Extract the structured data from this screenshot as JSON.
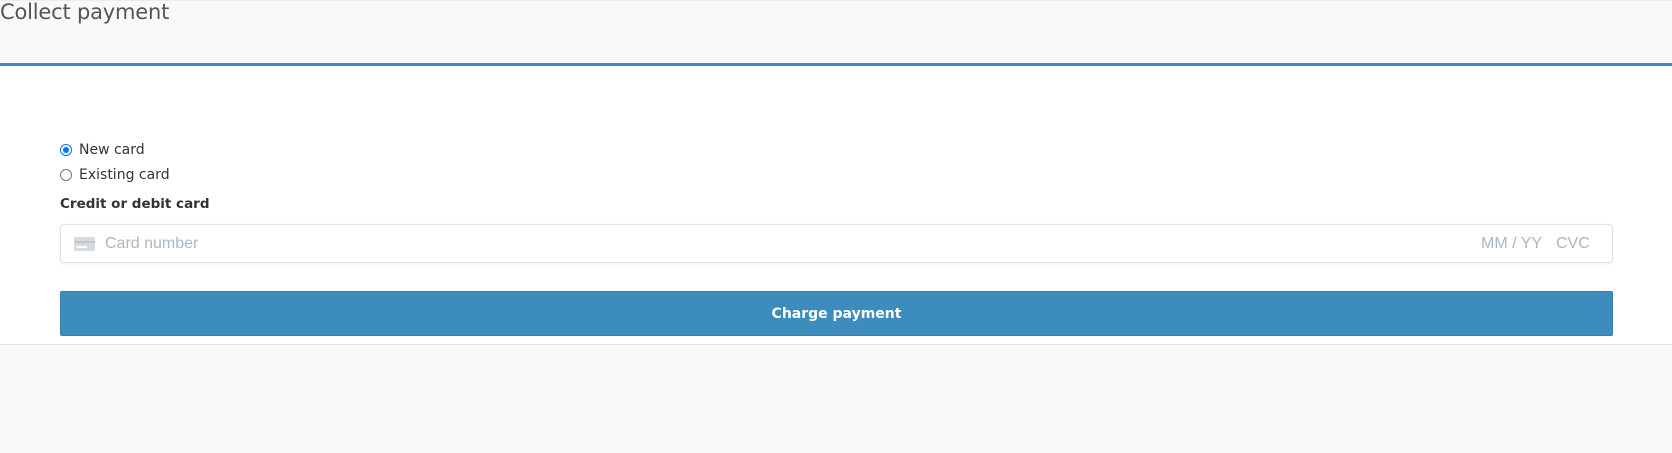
{
  "header": {
    "title": "Collect payment"
  },
  "payment": {
    "options": [
      {
        "label": "New card",
        "checked": true
      },
      {
        "label": "Existing card",
        "checked": false
      }
    ],
    "card_label": "Credit or debit card",
    "card_number_placeholder": "Card number",
    "expiry_placeholder": "MM / YY",
    "cvc_placeholder": "CVC",
    "card_icon": "generic-card-icon",
    "charge_label": "Charge payment"
  },
  "colors": {
    "accent": "#3c8dbc",
    "radio_selected": "#0075ff",
    "placeholder": "#aab7c4"
  }
}
